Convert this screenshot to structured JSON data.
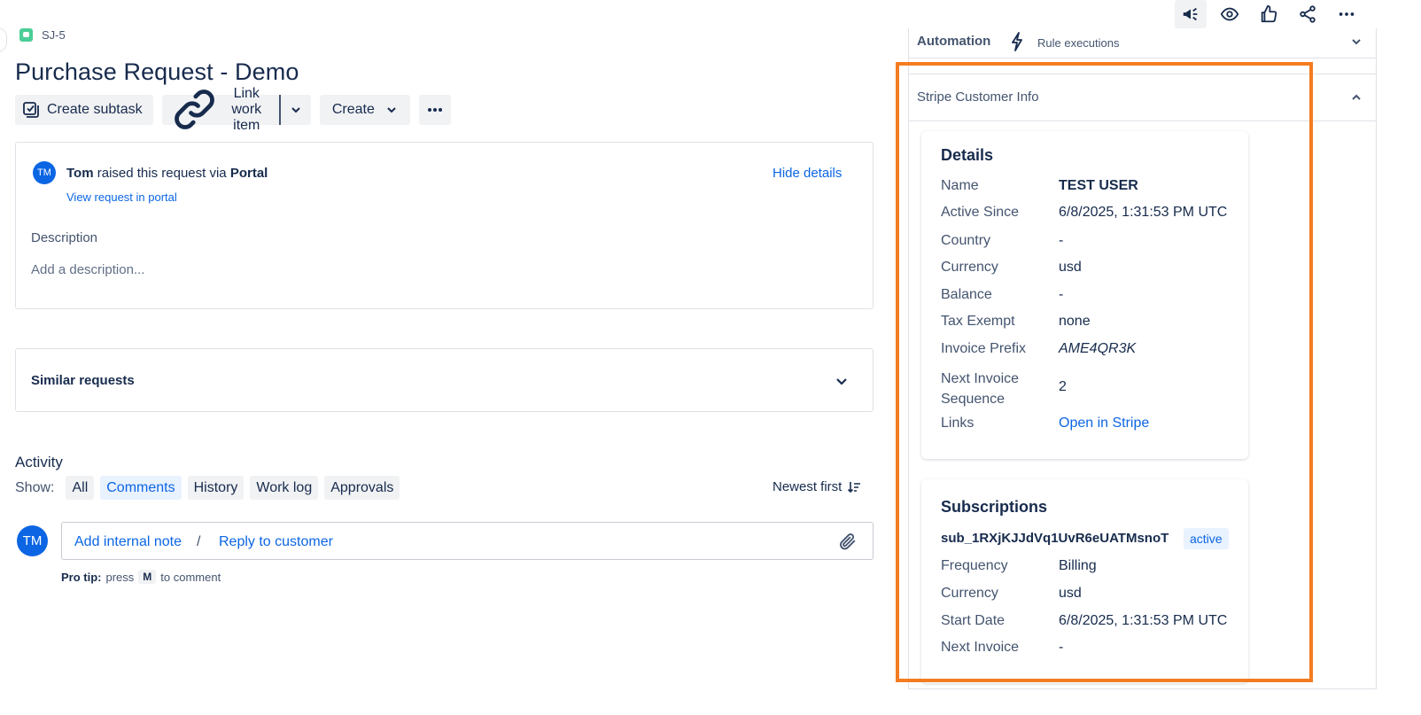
{
  "issue": {
    "key": "SJ-5",
    "title": "Purchase Request - Demo"
  },
  "toolbar": {
    "create_subtask": "Create subtask",
    "link_work_item": "Link work item",
    "create": "Create"
  },
  "request": {
    "avatar_initials": "TM",
    "reporter": "Tom",
    "raised_text": "raised this request via",
    "channel": "Portal",
    "view_portal": "View request in portal",
    "hide_details": "Hide details",
    "description_label": "Description",
    "description_placeholder": "Add a description..."
  },
  "similar": {
    "label": "Similar requests"
  },
  "activity": {
    "title": "Activity",
    "show_label": "Show:",
    "filters": [
      "All",
      "Comments",
      "History",
      "Work log",
      "Approvals"
    ],
    "active_filter": "Comments",
    "sort": "Newest first",
    "avatar_initials": "TM",
    "add_internal_note": "Add internal note",
    "separator": "/",
    "reply_to_customer": "Reply to customer",
    "pro_tip_label": "Pro tip:",
    "pro_tip_press": "press",
    "pro_tip_key": "M",
    "pro_tip_rest": "to comment"
  },
  "icons": {
    "top": [
      "megaphone-icon",
      "eye-icon",
      "thumbs-up-icon",
      "share-icon",
      "more-icon"
    ]
  },
  "automation": {
    "title": "Automation",
    "rule_executions": "Rule executions"
  },
  "stripe": {
    "title": "Stripe Customer Info",
    "details": {
      "title": "Details",
      "rows": [
        {
          "label": "Name",
          "value": "TEST USER"
        },
        {
          "label": "Active Since",
          "value": "6/8/2025, 1:31:53 PM UTC"
        },
        {
          "label": "Country",
          "value": "-"
        },
        {
          "label": "Currency",
          "value": "usd"
        },
        {
          "label": "Balance",
          "value": "-"
        },
        {
          "label": "Tax Exempt",
          "value": "none"
        },
        {
          "label": "Invoice Prefix",
          "value": "AME4QR3K"
        },
        {
          "label": "Next Invoice Sequence",
          "value": "2"
        },
        {
          "label": "Links",
          "value": "Open in Stripe"
        }
      ]
    },
    "subscriptions": {
      "title": "Subscriptions",
      "id": "sub_1RXjKJJdVq1UvR6eUATMsnoT",
      "status": "active",
      "rows": [
        {
          "label": "Frequency",
          "value": "Billing"
        },
        {
          "label": "Currency",
          "value": "usd"
        },
        {
          "label": "Start Date",
          "value": "6/8/2025, 1:31:53 PM UTC"
        },
        {
          "label": "Next Invoice",
          "value": "-"
        }
      ]
    }
  },
  "colors": {
    "link": "#0c66e4",
    "highlight": "#f47c20",
    "issue_type": "#4bce97"
  }
}
